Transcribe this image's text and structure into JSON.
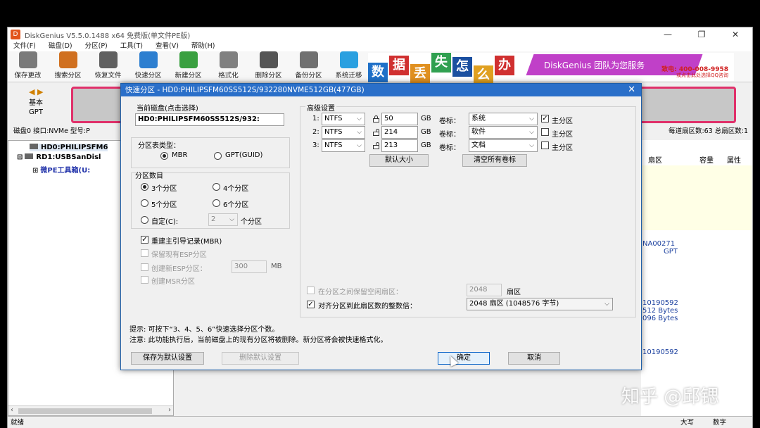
{
  "window": {
    "title": "DiskGenius V5.5.0.1488 x64 免费版(单文件PE版)",
    "controls": [
      "—",
      "❐",
      "✕"
    ]
  },
  "menu": [
    "文件(F)",
    "磁盘(D)",
    "分区(P)",
    "工具(T)",
    "查看(V)",
    "帮助(H)"
  ],
  "toolbar": [
    {
      "label": "保存更改",
      "icon": "save-icon",
      "color": "#7a7a7a"
    },
    {
      "label": "搜索分区",
      "icon": "search-icon",
      "color": "#d07020"
    },
    {
      "label": "恢复文件",
      "icon": "recover-icon",
      "color": "#606060"
    },
    {
      "label": "快速分区",
      "icon": "quick-partition-icon",
      "color": "#2d7fd0"
    },
    {
      "label": "新建分区",
      "icon": "new-partition-icon",
      "color": "#3aa040"
    },
    {
      "label": "格式化",
      "icon": "format-icon",
      "color": "#808080"
    },
    {
      "label": "删除分区",
      "icon": "delete-icon",
      "color": "#555555"
    },
    {
      "label": "备份分区",
      "icon": "backup-icon",
      "color": "#707070"
    },
    {
      "label": "系统迁移",
      "icon": "migrate-icon",
      "color": "#2aa0e0"
    }
  ],
  "banner": {
    "tiles": [
      {
        "text": "数",
        "color": "#1f70c8"
      },
      {
        "text": "据",
        "color": "#d03030"
      },
      {
        "text": "丢",
        "color": "#e09020"
      },
      {
        "text": "失",
        "color": "#30a050"
      },
      {
        "text": "怎",
        "color": "#1a4fa0"
      },
      {
        "text": "么",
        "color": "#e0a020"
      },
      {
        "text": "办",
        "color": "#d03030"
      }
    ],
    "slogan": "DiskGenius 团队为您服务",
    "phone": "致电: 400-008-9958",
    "qq": "或点击此处选择QQ咨询"
  },
  "diskbar": {
    "nav": "◀ ▶",
    "type_line1": "基本",
    "type_line2": "GPT"
  },
  "infobar": {
    "left": "磁盘0 接口:NVMe  型号:P",
    "right": "每道扇区数:63  总扇区数:1"
  },
  "tree": {
    "disk0": "HD0:PHILIPSFM6",
    "disk1": "RD1:USBSanDisl",
    "sub": "微PE工具箱(U:"
  },
  "right_pane": {
    "headers": [
      "扇区",
      "容量",
      "属性"
    ],
    "lines": [
      "NA00271",
      "GPT",
      "10190592",
      "512 Bytes",
      "096 Bytes",
      "10190592"
    ]
  },
  "status": {
    "ready": "就绪",
    "caps": "大写",
    "num": "数字"
  },
  "watermark": "知乎 @邱锶",
  "dialog": {
    "title": "快速分区 - HD0:PHILIPSFM60SS512S/932280NVME512GB(477GB)",
    "current_disk_label": "当前磁盘(点击选择)",
    "current_disk_value": "HD0:PHILIPSFM60SS512S/932:",
    "table_type_label": "分区表类型：",
    "table_types": [
      "MBR",
      "GPT(GUID)"
    ],
    "count_label": "分区数目",
    "counts": [
      "3个分区",
      "4个分区",
      "5个分区",
      "6个分区"
    ],
    "custom_label": "自定(C):",
    "custom_value": "2",
    "custom_unit": "个分区",
    "rebuild_mbr": "重建主引导记录(MBR)",
    "keep_esp": "保留现有ESP分区",
    "create_esp": "创建新ESP分区：",
    "esp_size": "300",
    "esp_unit": "MB",
    "create_msr": "创建MSR分区",
    "advanced_label": "高级设置",
    "partitions": [
      {
        "num": "1:",
        "fs": "NTFS",
        "size": "50",
        "unit": "GB",
        "vol_label": "卷标：",
        "vol": "系统",
        "primary": "主分区",
        "primary_checked": "☑"
      },
      {
        "num": "2:",
        "fs": "NTFS",
        "size": "214",
        "unit": "GB",
        "vol_label": "卷标：",
        "vol": "软件",
        "primary": "主分区",
        "primary_checked": ""
      },
      {
        "num": "3:",
        "fs": "NTFS",
        "size": "213",
        "unit": "GB",
        "vol_label": "卷标：",
        "vol": "文档",
        "primary": "主分区",
        "primary_checked": ""
      }
    ],
    "default_size_btn": "默认大小",
    "clear_labels_btn": "清空所有卷标",
    "reserve_gap_label": "在分区之间保留空闲扇区：",
    "reserve_gap_value": "2048",
    "reserve_gap_unit": "扇区",
    "align_label": "对齐分区到此扇区数的整数倍：",
    "align_value": "2048 扇区 (1048576 字节)",
    "hint1": "提示: 可按下“3、4、5、6”快速选择分区个数。",
    "hint2": "注意: 此功能执行后，当前磁盘上的现有分区将被删除。新分区将会被快速格式化。",
    "save_default_btn": "保存为默认设置",
    "delete_default_btn": "删除默认设置",
    "ok_btn": "确定",
    "cancel_btn": "取消"
  }
}
